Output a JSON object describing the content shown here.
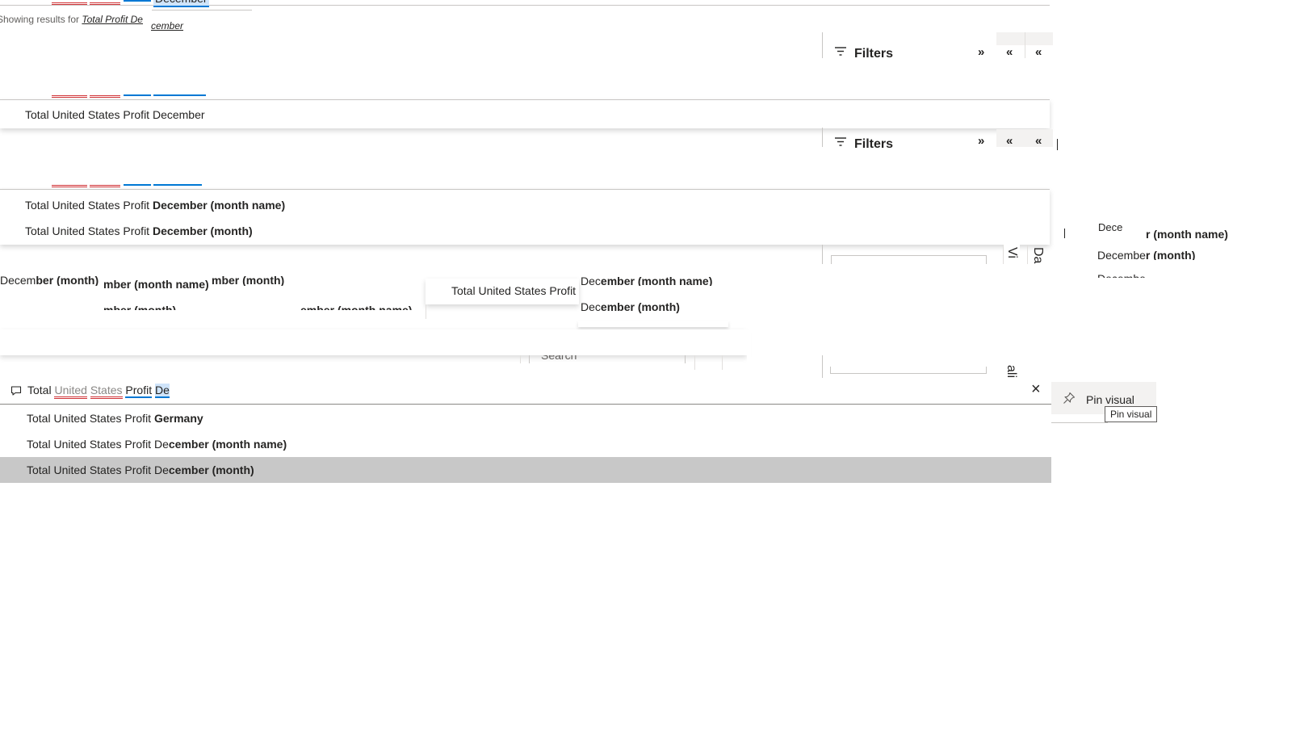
{
  "top_fragment": {
    "query_word": "December",
    "showing_prefix": "Showing results for",
    "showing_query_a": "Total Profit De",
    "showing_query_b": "cember"
  },
  "filters_panel_1": {
    "label": "Filters",
    "expand": "»",
    "collapse": "«"
  },
  "suggestion_a": {
    "text": "Total United States Profit December"
  },
  "filters_panel_2": {
    "label": "Filters",
    "expand": "»",
    "collapse": "«"
  },
  "suggestions_b": [
    {
      "prefix": "Total United States Profit ",
      "bold": "December (month name)"
    },
    {
      "prefix": "Total United States Profit ",
      "bold": "December (month)"
    }
  ],
  "right_fragment": {
    "line1_bold": "r (month name)",
    "line1_under": "Dece",
    "line2_a": "Decembe",
    "line2_b": "r (month)",
    "line3": "Decembe"
  },
  "side_tabs": {
    "tab1": "Vi",
    "tab2": "Da",
    "tab3": "ali"
  },
  "mid_fragment": {
    "frag1_a": "Decem",
    "frag1_b": "ber (month)",
    "frag2": "mber (month name)",
    "frag3": "mber (month)",
    "frag4": "mber (month)",
    "frag5": "ember (month name)",
    "center_prefix": "Total United States Profit",
    "right_line1_a": "Dec",
    "right_line1_b": "ember (month name)",
    "right_line2_a": "Dec",
    "right_line2_b": "ember (month)",
    "search_placeholder": "Search"
  },
  "qa": {
    "input": {
      "w1": "Total",
      "w2": "United",
      "w3": "States",
      "w4": "Profit",
      "w5": "De"
    },
    "clear_label": "×",
    "suggestions": [
      {
        "prefix": "Total United States Profit ",
        "bold": "Germany",
        "selected": false
      },
      {
        "prefix": "Total United States Profit ",
        "mid": "De",
        "bold": "cember (month name)",
        "selected": false
      },
      {
        "prefix": "Total United States Profit ",
        "mid": "De",
        "bold": "cember (month)",
        "selected": true
      }
    ]
  },
  "pin_visual": {
    "label": "Pin visual",
    "tooltip": "Pin visual"
  },
  "colors": {
    "selected_row": "#c8c8c8",
    "accent": "#0078d4",
    "spell": "#d13438"
  }
}
